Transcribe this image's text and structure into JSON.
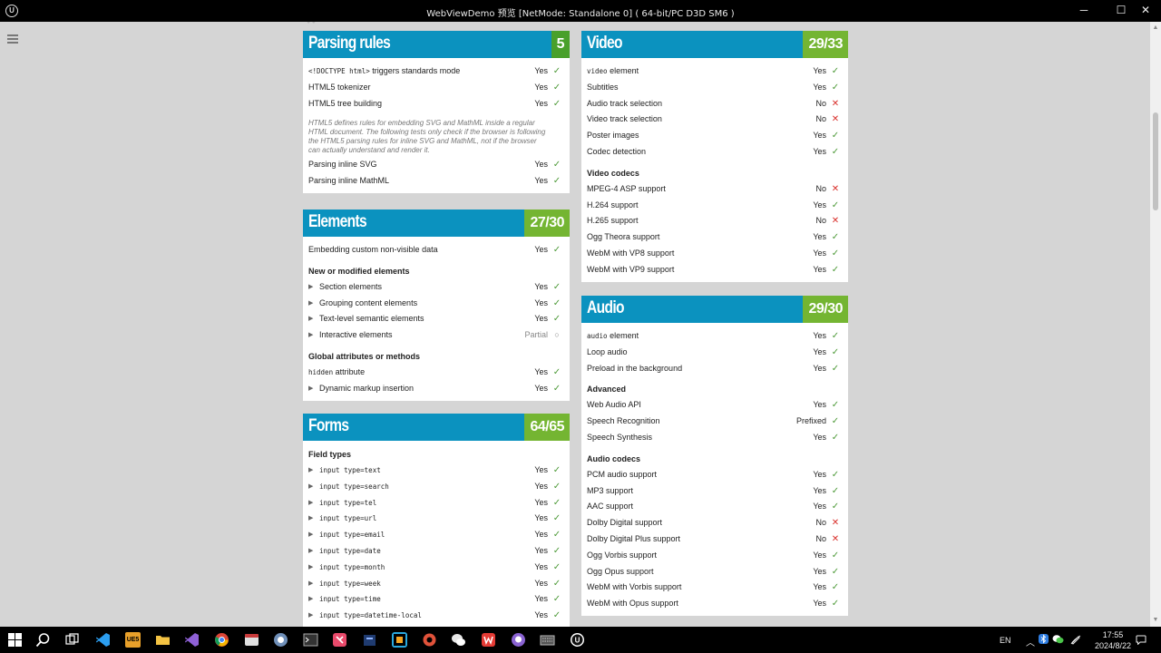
{
  "window": {
    "title": "WebViewDemo 预览 [NetMode: Standalone 0]  ( 64-bit/PC D3D SM6 )",
    "app_icon": "unreal-icon",
    "minimize": "─",
    "maximize": "☐",
    "close": "✕"
  },
  "menu_icon": "hamburger-icon",
  "sections": {
    "parsing": {
      "title": "Parsing rules",
      "score": "5",
      "rows": [
        {
          "code": "<!DOCTYPE html>",
          "label": " triggers standards mode",
          "result": "Yes"
        },
        {
          "label": "HTML5 tokenizer",
          "result": "Yes"
        },
        {
          "label": "HTML5 tree building",
          "result": "Yes"
        }
      ],
      "note": "HTML5 defines rules for embedding SVG and MathML inside a regular HTML document. The following tests only check if the browser is following the HTML5 parsing rules for inline SVG and MathML, not if the browser can actually understand and render it.",
      "rows2": [
        {
          "label": "Parsing inline SVG",
          "result": "Yes"
        },
        {
          "label": "Parsing inline MathML",
          "result": "Yes"
        }
      ]
    },
    "elements": {
      "title": "Elements",
      "score": "27/30",
      "row_embed": {
        "label": "Embedding custom non-visible data",
        "result": "Yes"
      },
      "cat_new": "New or modified elements",
      "new_rows": [
        {
          "label": "Section elements",
          "result": "Yes"
        },
        {
          "label": "Grouping content elements",
          "result": "Yes"
        },
        {
          "label": "Text-level semantic elements",
          "result": "Yes"
        },
        {
          "label": "Interactive elements",
          "result": "Partial"
        }
      ],
      "cat_global": "Global attributes or methods",
      "hidden_row": {
        "code": "hidden",
        "label": " attribute",
        "result": "Yes"
      },
      "dynamic_row": {
        "label": "Dynamic markup insertion",
        "result": "Yes"
      }
    },
    "forms": {
      "title": "Forms",
      "score": "64/65",
      "cat_fields": "Field types",
      "rows": [
        {
          "code": "input type=text",
          "result": "Yes"
        },
        {
          "code": "input type=search",
          "result": "Yes"
        },
        {
          "code": "input type=tel",
          "result": "Yes"
        },
        {
          "code": "input type=url",
          "result": "Yes"
        },
        {
          "code": "input type=email",
          "result": "Yes"
        },
        {
          "code": "input type=date",
          "result": "Yes"
        },
        {
          "code": "input type=month",
          "result": "Yes"
        },
        {
          "code": "input type=week",
          "result": "Yes"
        },
        {
          "code": "input type=time",
          "result": "Yes"
        },
        {
          "code": "input type=datetime-local",
          "result": "Yes"
        }
      ]
    },
    "video": {
      "title": "Video",
      "score": "29/33",
      "rows": [
        {
          "code": "video",
          "label": " element",
          "result": "Yes"
        },
        {
          "label": "Subtitles",
          "result": "Yes"
        },
        {
          "label": "Audio track selection",
          "result": "No"
        },
        {
          "label": "Video track selection",
          "result": "No"
        },
        {
          "label": "Poster images",
          "result": "Yes"
        },
        {
          "label": "Codec detection",
          "result": "Yes"
        }
      ],
      "cat_codecs": "Video codecs",
      "codec_rows": [
        {
          "label": "MPEG-4 ASP support",
          "result": "No"
        },
        {
          "label": "H.264 support",
          "result": "Yes"
        },
        {
          "label": "H.265 support",
          "result": "No"
        },
        {
          "label": "Ogg Theora support",
          "result": "Yes"
        },
        {
          "label": "WebM with VP8 support",
          "result": "Yes"
        },
        {
          "label": "WebM with VP9 support",
          "result": "Yes"
        }
      ]
    },
    "audio": {
      "title": "Audio",
      "score": "29/30",
      "rows": [
        {
          "code": "audio",
          "label": " element",
          "result": "Yes"
        },
        {
          "label": "Loop audio",
          "result": "Yes"
        },
        {
          "label": "Preload in the background",
          "result": "Yes"
        }
      ],
      "cat_advanced": "Advanced",
      "adv_rows": [
        {
          "label": "Web Audio API",
          "result": "Yes"
        },
        {
          "label": "Speech Recognition",
          "result": "Prefixed"
        },
        {
          "label": "Speech Synthesis",
          "result": "Yes"
        }
      ],
      "cat_codecs": "Audio codecs",
      "codec_rows": [
        {
          "label": "PCM audio support",
          "result": "Yes"
        },
        {
          "label": "MP3 support",
          "result": "Yes"
        },
        {
          "label": "AAC support",
          "result": "Yes"
        },
        {
          "label": "Dolby Digital support",
          "result": "No"
        },
        {
          "label": "Dolby Digital Plus support",
          "result": "No"
        },
        {
          "label": "Ogg Vorbis support",
          "result": "Yes"
        },
        {
          "label": "Ogg Opus support",
          "result": "Yes"
        },
        {
          "label": "WebM with Vorbis support",
          "result": "Yes"
        },
        {
          "label": "WebM with Opus support",
          "result": "Yes"
        }
      ]
    }
  },
  "marks": {
    "Yes": "✓",
    "No": "✕",
    "Partial": "○",
    "Prefixed": "✓"
  },
  "colors": {
    "header_blue": "#0b92bf",
    "score_green": "#74b532",
    "yes_green": "#4d9a38",
    "no_red": "#d9302c"
  },
  "taskbar": {
    "apps": [
      "windows-start-icon",
      "search-icon",
      "task-view-icon",
      "vscode-icon",
      "ue5-icon",
      "file-explorer-icon",
      "visual-studio-icon",
      "chrome-icon",
      "browser-icon",
      "terminal-icon",
      "app-icon",
      "app-icon",
      "app-icon",
      "app-icon",
      "wechat-icon",
      "wps-icon",
      "github-icon",
      "keyboard-icon",
      "unreal-icon"
    ],
    "ue5_label": "UE5",
    "lang": "EN",
    "time": "17:55",
    "date": "2024/8/22"
  }
}
